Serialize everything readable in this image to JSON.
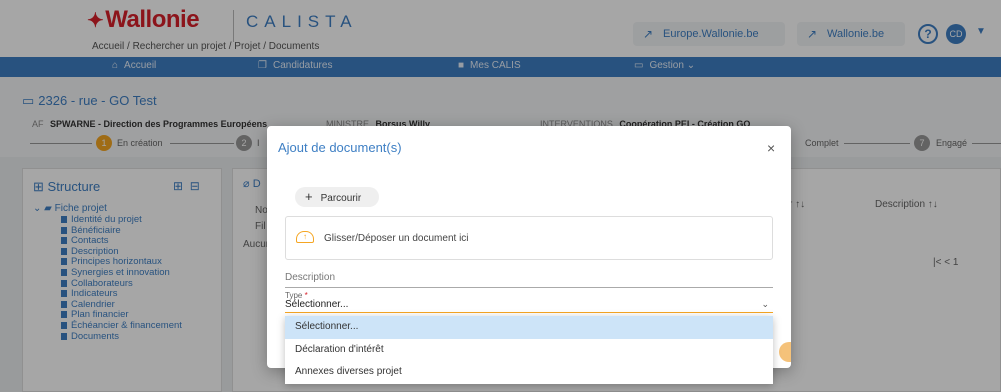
{
  "header": {
    "logo_text": "Wallonie",
    "app_name": "CALISTA",
    "breadcrumb": "Accueil / Rechercher un projet / Projet / Documents",
    "btn_europe": "Europe.Wallonie.be",
    "btn_wallonie": "Wallonie.be",
    "help": "?",
    "avatar_initials": "CD"
  },
  "nav": {
    "accueil": "Accueil",
    "candidatures": "Candidatures",
    "mes_calis": "Mes CALIS",
    "gestion": "Gestion"
  },
  "project": {
    "title": "2326 - rue - GO Test",
    "af_label": "AF",
    "af_value": "SPWARNE - Direction des Programmes Européens",
    "ministre_label": "MINISTRE",
    "ministre_value": "Borsus Willy",
    "interventions_label": "INTERVENTIONS",
    "interventions_value": "Coopération PEI - Création GO",
    "step1_num": "1",
    "step1_label": "En création",
    "step2_num": "2",
    "step2_label": "I",
    "step_complet_label": "Complet",
    "step7_num": "7",
    "step7_label": "Engagé"
  },
  "sidebar": {
    "title": "Structure",
    "root": "Fiche projet",
    "items": [
      "Identité du projet",
      "Bénéficiaire",
      "Contacts",
      "Description",
      "Principes horizontaux",
      "Synergies et innovation",
      "Collaborateurs",
      "Indicateurs",
      "Calendrier",
      "Plan financier",
      "Échéancier & financement",
      "Documents"
    ]
  },
  "center": {
    "title": "D",
    "col_nom": "Nor",
    "col_fil": "Fil",
    "aucun": "Aucun",
    "col_sort": "r ↑↓",
    "col_description": "Description ↑↓",
    "pager": "1"
  },
  "modal": {
    "title": "Ajout de document(s)",
    "close": "×",
    "browse_label": "Parcourir",
    "drop_label": "Glisser/Déposer un document ici",
    "description_placeholder": "Description",
    "type_label": "Type",
    "type_required": "*",
    "type_value": "Sélectionner..."
  },
  "dropdown": {
    "options": [
      "Sélectionner...",
      "Déclaration d'intérêt",
      "Annexes diverses projet"
    ]
  }
}
